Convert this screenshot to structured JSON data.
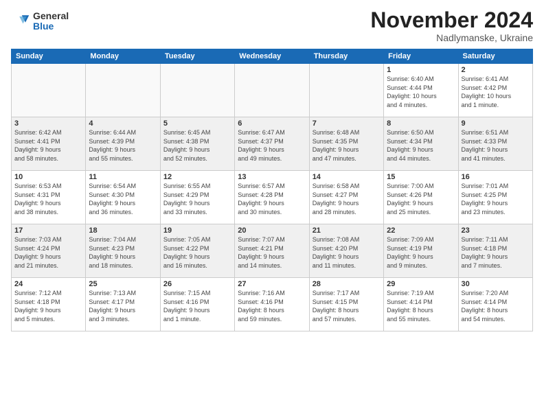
{
  "logo": {
    "general": "General",
    "blue": "Blue"
  },
  "title": "November 2024",
  "location": "Nadlymanske, Ukraine",
  "headers": [
    "Sunday",
    "Monday",
    "Tuesday",
    "Wednesday",
    "Thursday",
    "Friday",
    "Saturday"
  ],
  "weeks": [
    [
      {
        "day": "",
        "info": ""
      },
      {
        "day": "",
        "info": ""
      },
      {
        "day": "",
        "info": ""
      },
      {
        "day": "",
        "info": ""
      },
      {
        "day": "",
        "info": ""
      },
      {
        "day": "1",
        "info": "Sunrise: 6:40 AM\nSunset: 4:44 PM\nDaylight: 10 hours\nand 4 minutes."
      },
      {
        "day": "2",
        "info": "Sunrise: 6:41 AM\nSunset: 4:42 PM\nDaylight: 10 hours\nand 1 minute."
      }
    ],
    [
      {
        "day": "3",
        "info": "Sunrise: 6:42 AM\nSunset: 4:41 PM\nDaylight: 9 hours\nand 58 minutes."
      },
      {
        "day": "4",
        "info": "Sunrise: 6:44 AM\nSunset: 4:39 PM\nDaylight: 9 hours\nand 55 minutes."
      },
      {
        "day": "5",
        "info": "Sunrise: 6:45 AM\nSunset: 4:38 PM\nDaylight: 9 hours\nand 52 minutes."
      },
      {
        "day": "6",
        "info": "Sunrise: 6:47 AM\nSunset: 4:37 PM\nDaylight: 9 hours\nand 49 minutes."
      },
      {
        "day": "7",
        "info": "Sunrise: 6:48 AM\nSunset: 4:35 PM\nDaylight: 9 hours\nand 47 minutes."
      },
      {
        "day": "8",
        "info": "Sunrise: 6:50 AM\nSunset: 4:34 PM\nDaylight: 9 hours\nand 44 minutes."
      },
      {
        "day": "9",
        "info": "Sunrise: 6:51 AM\nSunset: 4:33 PM\nDaylight: 9 hours\nand 41 minutes."
      }
    ],
    [
      {
        "day": "10",
        "info": "Sunrise: 6:53 AM\nSunset: 4:31 PM\nDaylight: 9 hours\nand 38 minutes."
      },
      {
        "day": "11",
        "info": "Sunrise: 6:54 AM\nSunset: 4:30 PM\nDaylight: 9 hours\nand 36 minutes."
      },
      {
        "day": "12",
        "info": "Sunrise: 6:55 AM\nSunset: 4:29 PM\nDaylight: 9 hours\nand 33 minutes."
      },
      {
        "day": "13",
        "info": "Sunrise: 6:57 AM\nSunset: 4:28 PM\nDaylight: 9 hours\nand 30 minutes."
      },
      {
        "day": "14",
        "info": "Sunrise: 6:58 AM\nSunset: 4:27 PM\nDaylight: 9 hours\nand 28 minutes."
      },
      {
        "day": "15",
        "info": "Sunrise: 7:00 AM\nSunset: 4:26 PM\nDaylight: 9 hours\nand 25 minutes."
      },
      {
        "day": "16",
        "info": "Sunrise: 7:01 AM\nSunset: 4:25 PM\nDaylight: 9 hours\nand 23 minutes."
      }
    ],
    [
      {
        "day": "17",
        "info": "Sunrise: 7:03 AM\nSunset: 4:24 PM\nDaylight: 9 hours\nand 21 minutes."
      },
      {
        "day": "18",
        "info": "Sunrise: 7:04 AM\nSunset: 4:23 PM\nDaylight: 9 hours\nand 18 minutes."
      },
      {
        "day": "19",
        "info": "Sunrise: 7:05 AM\nSunset: 4:22 PM\nDaylight: 9 hours\nand 16 minutes."
      },
      {
        "day": "20",
        "info": "Sunrise: 7:07 AM\nSunset: 4:21 PM\nDaylight: 9 hours\nand 14 minutes."
      },
      {
        "day": "21",
        "info": "Sunrise: 7:08 AM\nSunset: 4:20 PM\nDaylight: 9 hours\nand 11 minutes."
      },
      {
        "day": "22",
        "info": "Sunrise: 7:09 AM\nSunset: 4:19 PM\nDaylight: 9 hours\nand 9 minutes."
      },
      {
        "day": "23",
        "info": "Sunrise: 7:11 AM\nSunset: 4:18 PM\nDaylight: 9 hours\nand 7 minutes."
      }
    ],
    [
      {
        "day": "24",
        "info": "Sunrise: 7:12 AM\nSunset: 4:18 PM\nDaylight: 9 hours\nand 5 minutes."
      },
      {
        "day": "25",
        "info": "Sunrise: 7:13 AM\nSunset: 4:17 PM\nDaylight: 9 hours\nand 3 minutes."
      },
      {
        "day": "26",
        "info": "Sunrise: 7:15 AM\nSunset: 4:16 PM\nDaylight: 9 hours\nand 1 minute."
      },
      {
        "day": "27",
        "info": "Sunrise: 7:16 AM\nSunset: 4:16 PM\nDaylight: 8 hours\nand 59 minutes."
      },
      {
        "day": "28",
        "info": "Sunrise: 7:17 AM\nSunset: 4:15 PM\nDaylight: 8 hours\nand 57 minutes."
      },
      {
        "day": "29",
        "info": "Sunrise: 7:19 AM\nSunset: 4:14 PM\nDaylight: 8 hours\nand 55 minutes."
      },
      {
        "day": "30",
        "info": "Sunrise: 7:20 AM\nSunset: 4:14 PM\nDaylight: 8 hours\nand 54 minutes."
      }
    ]
  ]
}
